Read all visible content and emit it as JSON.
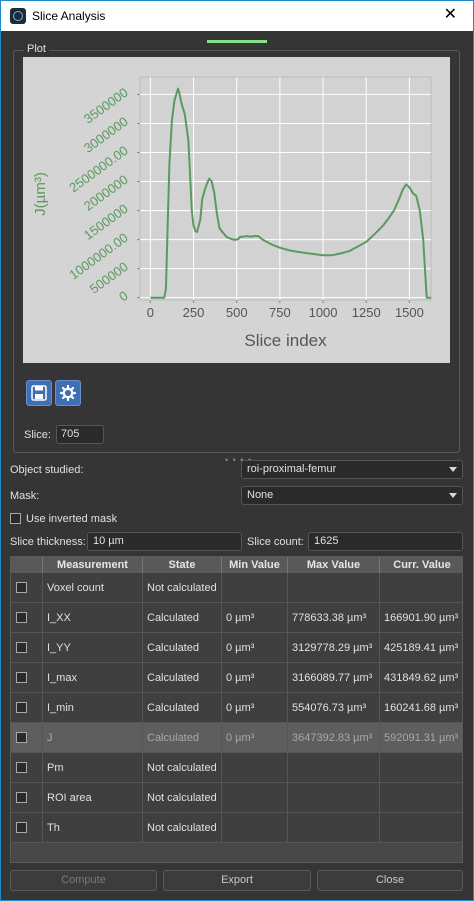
{
  "window": {
    "title": "Slice Analysis",
    "close_glyph": "✕"
  },
  "plot_group": {
    "title": "Plot"
  },
  "chart_data": {
    "type": "line",
    "xlabel": "Slice index",
    "ylabel": "J(µm³)",
    "xlim": [
      -60,
      1625
    ],
    "ylim": [
      -40000,
      3800000
    ],
    "x_ticks": [
      0,
      250,
      500,
      750,
      1000,
      1250,
      1500
    ],
    "x_tick_labels": [
      "0",
      "250",
      "500",
      "750",
      "1000",
      "1250",
      "1500"
    ],
    "y_ticks": [
      0,
      500000,
      1000000,
      1500000,
      2000000,
      2500000,
      3000000,
      3500000
    ],
    "y_tick_labels": [
      "0",
      "500000",
      "1000000.00",
      "1500000",
      "2000000",
      "2500000.00",
      "3000000",
      "3500000"
    ],
    "grid": true,
    "color": "#5a9a5e",
    "series": [
      {
        "x": [
          0,
          80,
          90,
          100,
          110,
          125,
          140,
          150,
          160,
          170,
          180,
          200,
          220,
          240,
          250,
          260,
          270,
          290,
          300,
          320,
          340,
          355,
          370,
          385,
          400,
          420,
          440,
          460,
          480,
          500,
          510,
          520,
          540,
          560,
          580,
          600,
          625,
          650,
          700,
          750,
          800,
          850,
          900,
          950,
          1000,
          1050,
          1100,
          1150,
          1200,
          1250,
          1300,
          1350,
          1380,
          1410,
          1440,
          1460,
          1480,
          1500,
          1520,
          1540,
          1560,
          1580,
          1600,
          1625
        ],
        "y": [
          0,
          0,
          150000,
          1200000,
          2300000,
          3050000,
          3400000,
          3500000,
          3600000,
          3500000,
          3350000,
          3150000,
          2700000,
          1500000,
          1250000,
          1150000,
          1130000,
          1350000,
          1700000,
          1900000,
          2050000,
          2000000,
          1800000,
          1450000,
          1200000,
          1120000,
          1050000,
          1020000,
          1000000,
          1000000,
          1010000,
          1050000,
          1050000,
          1060000,
          1050000,
          1060000,
          1060000,
          1000000,
          920000,
          860000,
          820000,
          790000,
          770000,
          750000,
          730000,
          730000,
          760000,
          800000,
          880000,
          960000,
          1100000,
          1250000,
          1370000,
          1500000,
          1700000,
          1850000,
          1950000,
          1900000,
          1800000,
          1750000,
          1500000,
          1000000,
          0,
          0
        ]
      }
    ]
  },
  "slice": {
    "label": "Slice:",
    "value": "705"
  },
  "object_studied": {
    "label": "Object studied:",
    "value": "roi-proximal-femur"
  },
  "mask": {
    "label": "Mask:",
    "value": "None"
  },
  "inverted_mask": {
    "label": "Use inverted mask",
    "checked": false
  },
  "slice_thickness": {
    "label": "Slice thickness:",
    "value": "10 µm"
  },
  "slice_count": {
    "label": "Slice count:",
    "value": "1625"
  },
  "table": {
    "columns": [
      "Measurement",
      "State",
      "Min Value",
      "Max Value",
      "Curr. Value"
    ],
    "rows": [
      {
        "measurement": "Voxel count",
        "state": "Not calculated",
        "min": "",
        "max": "",
        "curr": ""
      },
      {
        "measurement": "I_XX",
        "state": "Calculated",
        "min": "0 µm³",
        "max": "778633.38 µm³",
        "curr": "166901.90 µm³"
      },
      {
        "measurement": "I_YY",
        "state": "Calculated",
        "min": "0 µm³",
        "max": "3129778.29 µm³",
        "curr": "425189.41 µm³"
      },
      {
        "measurement": "I_max",
        "state": "Calculated",
        "min": "0 µm³",
        "max": "3166089.77 µm³",
        "curr": "431849.62 µm³"
      },
      {
        "measurement": "I_min",
        "state": "Calculated",
        "min": "0 µm³",
        "max": "554076.73 µm³",
        "curr": "160241.68 µm³"
      },
      {
        "measurement": "J",
        "state": "Calculated",
        "min": "0 µm³",
        "max": "3647392.83 µm³",
        "curr": "592091.31 µm³"
      },
      {
        "measurement": "Pm",
        "state": "Not calculated",
        "min": "",
        "max": "",
        "curr": ""
      },
      {
        "measurement": "ROI area",
        "state": "Not calculated",
        "min": "",
        "max": "",
        "curr": ""
      },
      {
        "measurement": "Th",
        "state": "Not calculated",
        "min": "",
        "max": "",
        "curr": ""
      }
    ],
    "selected_row": 5
  },
  "buttons": {
    "compute": "Compute",
    "export": "Export",
    "close": "Close"
  },
  "icons": {
    "save": "save-icon",
    "settings": "gear-icon"
  }
}
